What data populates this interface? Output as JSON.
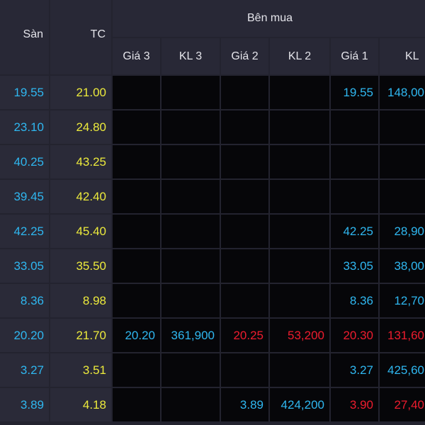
{
  "header": {
    "san": "Sàn",
    "tc": "TC",
    "ben_mua": "Bên mua",
    "gia3": "Giá 3",
    "kl3": "KL 3",
    "gia2": "Giá 2",
    "kl2": "KL 2",
    "gia1": "Giá 1",
    "kl1": "KL"
  },
  "colors": {
    "floor": "#2fb7f0",
    "reference": "#ecea3c",
    "increase": "#00e33a",
    "decrease": "#ee1c2e",
    "header_bg": "#282836",
    "cell_bg": "#2a2a38",
    "bid_bg": "#060609"
  },
  "rows": [
    {
      "san": "19.55",
      "tc": "21.00",
      "gia3": "",
      "gia3_c": "",
      "kl3": "",
      "kl3_c": "",
      "gia2": "",
      "gia2_c": "",
      "kl2": "",
      "kl2_c": "",
      "gia1": "19.55",
      "gia1_c": "blue",
      "kl1": "148,00",
      "kl1_c": "blue"
    },
    {
      "san": "23.10",
      "tc": "24.80",
      "gia3": "",
      "gia3_c": "",
      "kl3": "",
      "kl3_c": "",
      "gia2": "",
      "gia2_c": "",
      "kl2": "",
      "kl2_c": "",
      "gia1": "",
      "gia1_c": "",
      "kl1": "",
      "kl1_c": ""
    },
    {
      "san": "40.25",
      "tc": "43.25",
      "gia3": "",
      "gia3_c": "",
      "kl3": "",
      "kl3_c": "",
      "gia2": "",
      "gia2_c": "",
      "kl2": "",
      "kl2_c": "",
      "gia1": "",
      "gia1_c": "",
      "kl1": "",
      "kl1_c": ""
    },
    {
      "san": "39.45",
      "tc": "42.40",
      "gia3": "",
      "gia3_c": "",
      "kl3": "",
      "kl3_c": "",
      "gia2": "",
      "gia2_c": "",
      "kl2": "",
      "kl2_c": "",
      "gia1": "",
      "gia1_c": "",
      "kl1": "",
      "kl1_c": ""
    },
    {
      "san": "42.25",
      "tc": "45.40",
      "gia3": "",
      "gia3_c": "",
      "kl3": "",
      "kl3_c": "",
      "gia2": "",
      "gia2_c": "",
      "kl2": "",
      "kl2_c": "",
      "gia1": "42.25",
      "gia1_c": "blue",
      "kl1": "28,90",
      "kl1_c": "blue"
    },
    {
      "san": "33.05",
      "tc": "35.50",
      "gia3": "",
      "gia3_c": "",
      "kl3": "",
      "kl3_c": "",
      "gia2": "",
      "gia2_c": "",
      "kl2": "",
      "kl2_c": "",
      "gia1": "33.05",
      "gia1_c": "blue",
      "kl1": "38,00",
      "kl1_c": "blue"
    },
    {
      "san": "8.36",
      "tc": "8.98",
      "gia3": "",
      "gia3_c": "",
      "kl3": "",
      "kl3_c": "",
      "gia2": "",
      "gia2_c": "",
      "kl2": "",
      "kl2_c": "",
      "gia1": "8.36",
      "gia1_c": "blue",
      "kl1": "12,70",
      "kl1_c": "blue"
    },
    {
      "san": "20.20",
      "tc": "21.70",
      "gia3": "20.20",
      "gia3_c": "blue",
      "kl3": "361,900",
      "kl3_c": "blue",
      "gia2": "20.25",
      "gia2_c": "red",
      "kl2": "53,200",
      "kl2_c": "red",
      "gia1": "20.30",
      "gia1_c": "red",
      "kl1": "131,60",
      "kl1_c": "red"
    },
    {
      "san": "3.27",
      "tc": "3.51",
      "gia3": "",
      "gia3_c": "",
      "kl3": "",
      "kl3_c": "",
      "gia2": "",
      "gia2_c": "",
      "kl2": "",
      "kl2_c": "",
      "gia1": "3.27",
      "gia1_c": "blue",
      "kl1": "425,60",
      "kl1_c": "blue"
    },
    {
      "san": "3.89",
      "tc": "4.18",
      "gia3": "",
      "gia3_c": "",
      "kl3": "",
      "kl3_c": "",
      "gia2": "3.89",
      "gia2_c": "blue",
      "kl2": "424,200",
      "kl2_c": "blue",
      "gia1": "3.90",
      "gia1_c": "red",
      "kl1": "27,40",
      "kl1_c": "red"
    }
  ]
}
